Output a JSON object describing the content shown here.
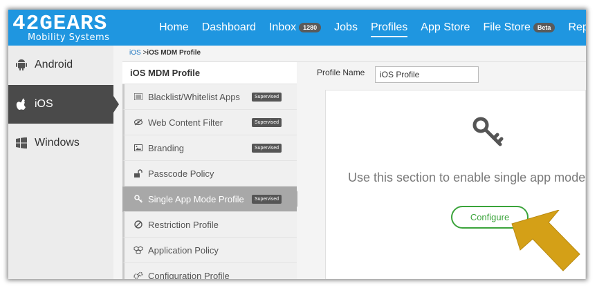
{
  "brand": {
    "logo_main": "42GEARS",
    "logo_sub": "Mobility Systems"
  },
  "nav": {
    "items": [
      {
        "label": "Home",
        "badge": null,
        "active": false
      },
      {
        "label": "Dashboard",
        "badge": null,
        "active": false
      },
      {
        "label": "Inbox",
        "badge": "1280",
        "active": false
      },
      {
        "label": "Jobs",
        "badge": null,
        "active": false
      },
      {
        "label": "Profiles",
        "badge": null,
        "active": true
      },
      {
        "label": "App Store",
        "badge": null,
        "active": false
      },
      {
        "label": "File Store",
        "badge": "Beta",
        "active": false
      },
      {
        "label": "Reports",
        "badge": null,
        "active": false
      }
    ]
  },
  "os_sidebar": {
    "items": [
      {
        "label": "Android",
        "icon": "android-icon"
      },
      {
        "label": "iOS",
        "icon": "apple-icon",
        "active": true
      },
      {
        "label": "Windows",
        "icon": "windows-icon"
      }
    ]
  },
  "breadcrumb": {
    "link": "iOS",
    "separator": ">",
    "current": "iOS MDM Profile"
  },
  "profile_list": {
    "title": "iOS MDM Profile",
    "supervised_label": "Supervised",
    "items": [
      {
        "label": "Blacklist/Whitelist Apps",
        "icon": "list-icon",
        "supervised": true
      },
      {
        "label": "Web Content Filter",
        "icon": "eye-slash-icon",
        "supervised": true
      },
      {
        "label": "Branding",
        "icon": "image-icon",
        "supervised": true
      },
      {
        "label": "Passcode Policy",
        "icon": "unlock-icon",
        "supervised": false
      },
      {
        "label": "Single App Mode Profile",
        "icon": "key-icon",
        "supervised": true,
        "active": true
      },
      {
        "label": "Restriction Profile",
        "icon": "ban-icon",
        "supervised": false
      },
      {
        "label": "Application Policy",
        "icon": "cubes-icon",
        "supervised": false
      },
      {
        "label": "Configuration Profile",
        "icon": "gears-icon",
        "supervised": false
      }
    ]
  },
  "main": {
    "profile_name_label": "Profile Name",
    "profile_name_value": "iOS Profile",
    "message": "Use this section to enable single app mode",
    "configure_label": "Configure"
  },
  "colors": {
    "topbar": "#1f96e0",
    "accent_green": "#3aa33a",
    "arrow": "#d4a017"
  }
}
